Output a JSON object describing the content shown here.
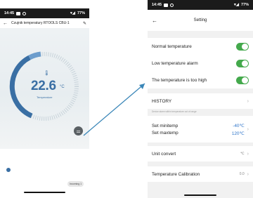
{
  "status_bar": {
    "time": "14:45",
    "battery": "77%"
  },
  "left": {
    "title": "Czujnik temperatury RTOOLS CBU-1",
    "temperature": "22.6",
    "unit": "°C",
    "label": "Temperature",
    "tag": "Incoming 1"
  },
  "right": {
    "title": "Setting",
    "toggles": [
      {
        "label": "Normal temperature",
        "on": true
      },
      {
        "label": "Low temperature alarm",
        "on": true
      },
      {
        "label": "The temperature is too high",
        "on": true
      }
    ],
    "history": "HISTORY",
    "caption": "Device alarm within temperature out of range",
    "min_label": "Set minitemp",
    "min_value": "-40℃",
    "max_label": "Set maxtemp",
    "max_value": "120℃",
    "unit_convert_label": "Unit convert",
    "unit_convert_value": "℃",
    "calibration_label": "Temperature Calibration",
    "calibration_value": "0.0"
  },
  "colors": {
    "accent": "#3a6fa4",
    "switch_on": "#44a94c",
    "value_blue": "#2d74c9"
  },
  "icons": [
    "back-arrow-icon",
    "edit-icon",
    "thermometer-icon",
    "sliders-icon",
    "chevron-right-icon"
  ]
}
